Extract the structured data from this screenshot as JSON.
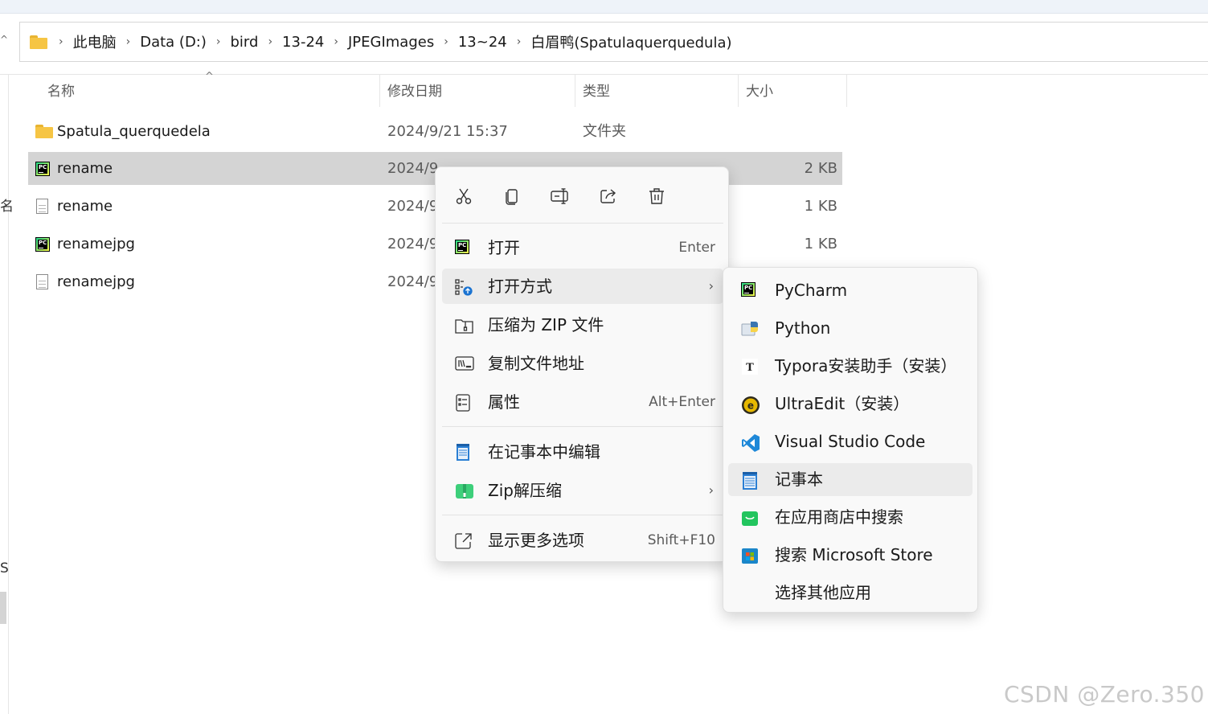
{
  "breadcrumb": [
    "此电脑",
    "Data (D:)",
    "bird",
    "13-24",
    "JPEGImages",
    "13~24",
    "白眉鸭(Spatulaquerquedula)"
  ],
  "nav_fragments": [
    "名",
    "S"
  ],
  "columns": {
    "name": "名称",
    "date": "修改日期",
    "type": "类型",
    "size": "大小"
  },
  "files": [
    {
      "icon": "folder-icon",
      "name": "Spatula_querquedela",
      "date": "2024/9/21 15:37",
      "type": "文件夹",
      "size": ""
    },
    {
      "icon": "pycharm-icon",
      "name": "rename",
      "date": "2024/9",
      "type": "",
      "size": "2 KB"
    },
    {
      "icon": "text-file-icon",
      "name": "rename",
      "date": "2024/9",
      "type": "",
      "size": "1 KB"
    },
    {
      "icon": "pycharm-icon",
      "name": "renamejpg",
      "date": "2024/9",
      "type": "",
      "size": "1 KB"
    },
    {
      "icon": "text-file-icon",
      "name": "renamejpg",
      "date": "2024/9",
      "type": "",
      "size": ""
    }
  ],
  "context_menu": {
    "toolbar": [
      "cut-icon",
      "copy-icon",
      "rename-icon",
      "share-icon",
      "delete-icon"
    ],
    "items": [
      {
        "label": "打开",
        "shortcut": "Enter",
        "icon": "pycharm-icon"
      },
      {
        "label": "打开方式",
        "shortcut": "",
        "icon": "open-with-icon"
      },
      {
        "label": "压缩为 ZIP 文件",
        "shortcut": "",
        "icon": "zip-folder-icon"
      },
      {
        "label": "复制文件地址",
        "shortcut": "",
        "icon": "copy-path-icon"
      },
      {
        "label": "属性",
        "shortcut": "Alt+Enter",
        "icon": "properties-icon"
      },
      {
        "label": "在记事本中编辑",
        "shortcut": "",
        "icon": "notepad-icon"
      },
      {
        "label": "Zip解压缩",
        "shortcut": "",
        "icon": "zip-extract-icon"
      },
      {
        "label": "显示更多选项",
        "shortcut": "Shift+F10",
        "icon": "more-options-icon"
      }
    ]
  },
  "open_with_menu": [
    {
      "label": "PyCharm",
      "icon": "pycharm-icon"
    },
    {
      "label": "Python",
      "icon": "python-icon"
    },
    {
      "label": "Typora安装助手（安装）",
      "icon": "typora-icon"
    },
    {
      "label": "UltraEdit（安装）",
      "icon": "ultraedit-icon"
    },
    {
      "label": "Visual Studio Code",
      "icon": "vscode-icon"
    },
    {
      "label": "记事本",
      "icon": "notepad-icon"
    },
    {
      "label": "在应用商店中搜索",
      "icon": "store-search-icon"
    },
    {
      "label": "搜索 Microsoft Store",
      "icon": "microsoft-store-icon"
    },
    {
      "label": "选择其他应用",
      "icon": ""
    }
  ],
  "watermark": "CSDN @Zero.350"
}
